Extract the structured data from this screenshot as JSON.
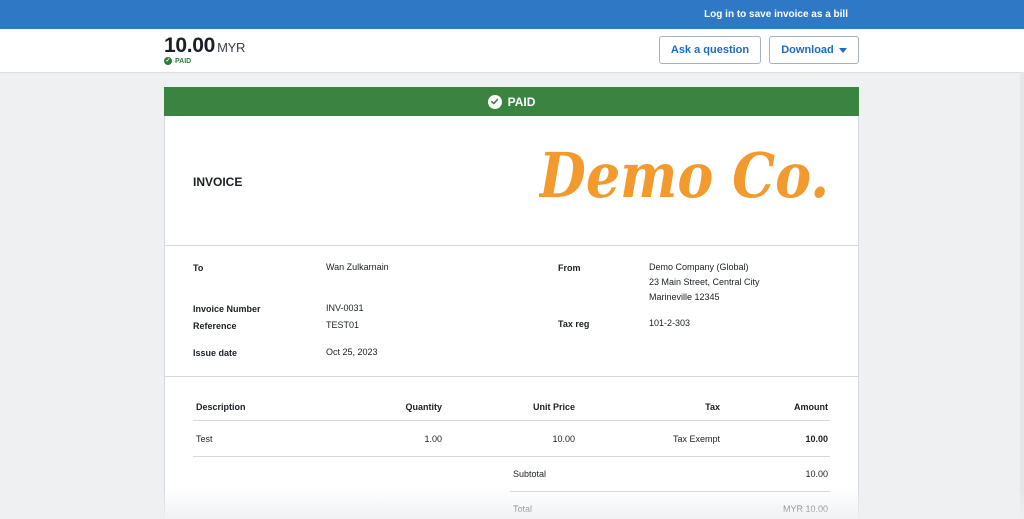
{
  "topbar": {
    "login_text": "Log in to save invoice as a bill"
  },
  "header": {
    "amount": "10.00",
    "currency": "MYR",
    "status": "PAID",
    "ask_label": "Ask a question",
    "download_label": "Download"
  },
  "banner": {
    "status": "PAID"
  },
  "invoice": {
    "title": "INVOICE",
    "logo_text": "Demo Co.",
    "to_label": "To",
    "to_value": "Wan Zulkarnain",
    "number_label": "Invoice Number",
    "number_value": "INV-0031",
    "reference_label": "Reference",
    "reference_value": "TEST01",
    "issue_label": "Issue date",
    "issue_value": "Oct 25, 2023",
    "from_label": "From",
    "from_lines": [
      "Demo Company (Global)",
      "23 Main Street, Central City",
      "Marineville 12345"
    ],
    "taxreg_label": "Tax reg",
    "taxreg_value": "101-2-303"
  },
  "table": {
    "headers": {
      "description": "Description",
      "quantity": "Quantity",
      "unit_price": "Unit Price",
      "tax": "Tax",
      "amount": "Amount"
    },
    "rows": [
      {
        "description": "Test",
        "quantity": "1.00",
        "unit_price": "10.00",
        "tax": "Tax Exempt",
        "amount": "10.00"
      }
    ],
    "subtotal_label": "Subtotal",
    "subtotal_value": "10.00",
    "total_label": "Total",
    "total_value": "MYR 10.00"
  },
  "colors": {
    "topbar": "#2f78c6",
    "paid_green": "#3a8341",
    "logo_orange": "#f29a2e",
    "link_blue": "#1f6bbf"
  }
}
